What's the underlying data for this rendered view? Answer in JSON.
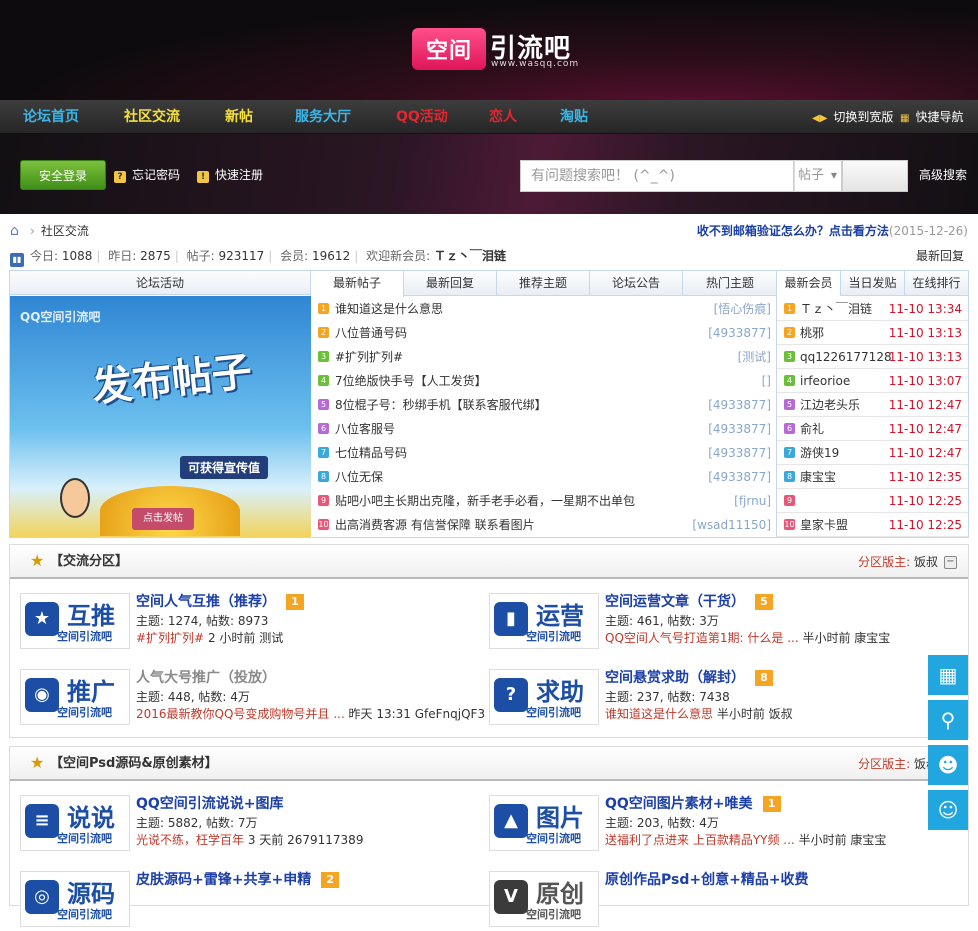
{
  "header": {
    "logo_mark": "空间",
    "logo_word": "引流吧",
    "logo_url": "www.wasqq.com"
  },
  "nav": {
    "items": [
      {
        "label": "论坛首页",
        "color": "#3ab7e8"
      },
      {
        "label": "社区交流",
        "color": "#f5e13a"
      },
      {
        "label": "新帖",
        "color": "#f5e13a"
      },
      {
        "label": "服务大厅",
        "color": "#3ab7e8"
      },
      {
        "label": "QQ活动",
        "color": "#e8242e"
      },
      {
        "label": "恋人",
        "color": "#e8242e"
      },
      {
        "label": "淘贴",
        "color": "#3ab7e8"
      }
    ],
    "switch_wide": "切换到宽版",
    "quick_nav": "快捷导航"
  },
  "login": {
    "button": "安全登录",
    "forgot": "忘记密码",
    "register": "快速注册",
    "search_placeholder": "有问题搜索吧！ (^_^)",
    "search_type": "帖子",
    "advanced": "高级搜索"
  },
  "breadcrumb": {
    "current": "社区交流"
  },
  "notice": {
    "link": "收不到邮箱验证怎么办？点击看方法",
    "date": "(2015-12-26)"
  },
  "stats": {
    "today_label": "今日:",
    "today": "1088",
    "yesterday_label": "昨日:",
    "yesterday": "2875",
    "posts_label": "帖子:",
    "posts": "923117",
    "members_label": "会员:",
    "members": "19612",
    "welcome_label": "欢迎新会员:",
    "new_member": "Ｔｚ丶￣泪链",
    "latest_reply": "最新回复"
  },
  "activity": {
    "head": "论坛活动",
    "brand": "QQ空间引流吧",
    "big": "发布帖子",
    "sub": "可获得宣传值",
    "btn": "点击发帖"
  },
  "post_tabs": [
    "最新帖子",
    "最新回复",
    "推荐主题",
    "论坛公告",
    "热门主题"
  ],
  "posts": [
    {
      "n": "1",
      "title": "谁知道这是什么意思",
      "author": "[悟心伤痕]",
      "color": "#f5a521"
    },
    {
      "n": "2",
      "title": "八位普通号码",
      "author": "[4933877]",
      "color": "#f5a521"
    },
    {
      "n": "3",
      "title": "#扩列扩列#",
      "author": "[测试]",
      "color": "#6cbf3b"
    },
    {
      "n": "4",
      "title": "7位绝版快手号【人工发货】",
      "author": "[]",
      "color": "#6cbf3b"
    },
    {
      "n": "5",
      "title": "8位棍子号：秒绑手机【联系客服代绑】",
      "author": "[4933877]",
      "color": "#b56bd6"
    },
    {
      "n": "6",
      "title": "八位客服号",
      "author": "[4933877]",
      "color": "#b56bd6"
    },
    {
      "n": "7",
      "title": "七位精品号码",
      "author": "[4933877]",
      "color": "#3aa8d8"
    },
    {
      "n": "8",
      "title": "八位无保",
      "author": "[4933877]",
      "color": "#3aa8d8"
    },
    {
      "n": "9",
      "title": "贴吧小吧主长期出克隆，新手老手必看，一星期不出单包",
      "author": "[fjrnu]",
      "color": "#e8577a"
    },
    {
      "n": "10",
      "title": "出高消费客源  有信誉保障  联系看图片",
      "author": "[wsad11150]",
      "color": "#e8577a"
    }
  ],
  "member_tabs": [
    "最新会员",
    "当日发贴",
    "在线排行"
  ],
  "members": [
    {
      "n": "1",
      "name": "Ｔｚ丶￣泪链",
      "time": "11-10 13:34",
      "color": "#f5a521"
    },
    {
      "n": "2",
      "name": "桃邪",
      "time": "11-10 13:13",
      "color": "#f5a521"
    },
    {
      "n": "3",
      "name": "qq1226177128",
      "time": "11-10 13:13",
      "color": "#6cbf3b"
    },
    {
      "n": "4",
      "name": "irfeorioe",
      "time": "11-10 13:07",
      "color": "#6cbf3b"
    },
    {
      "n": "5",
      "name": "江边老头乐",
      "time": "11-10 12:47",
      "color": "#b56bd6"
    },
    {
      "n": "6",
      "name": "俞礼",
      "time": "11-10 12:47",
      "color": "#b56bd6"
    },
    {
      "n": "7",
      "name": "游侠19",
      "time": "11-10 12:47",
      "color": "#3aa8d8"
    },
    {
      "n": "8",
      "name": "康宝宝",
      "time": "11-10 12:35",
      "color": "#3aa8d8"
    },
    {
      "n": "9",
      "name": "",
      "time": "11-10 12:25",
      "color": "#e8577a"
    },
    {
      "n": "10",
      "name": "皇家卡盟",
      "time": "11-10 12:25",
      "color": "#e8577a"
    }
  ],
  "section1": {
    "title": "【交流分区】",
    "moderator_label": "分区版主:",
    "moderator": "饭叔",
    "forums": [
      {
        "icon_big": "互推",
        "icon_site": "空间引流吧",
        "icon_pic": "★",
        "name": "空间人气互推（推荐）",
        "badge": "1",
        "stats": "主题: 1274, 帖数: 8973",
        "last": "#扩列扩列#",
        "last_time": "2 小时前  测试"
      },
      {
        "icon_big": "运营",
        "icon_site": "空间引流吧",
        "icon_pic": "▮",
        "name": "空间运营文章（干货）",
        "badge": "5",
        "stats": "主题: 461, 帖数: 3万",
        "last": "QQ空间人气号打造第1期: 什么是 ...",
        "last_time": "半小时前  康宝宝"
      },
      {
        "icon_big": "推广",
        "icon_site": "空间引流吧",
        "icon_pic": "◉",
        "name": "人气大号推广（投放）",
        "badge": "",
        "stats": "主题: 448, 帖数: 4万",
        "last": "2016最新教你QQ号变成购物号并且 ...",
        "last_time": "昨天 13:31  GfeFnqjQF3"
      },
      {
        "icon_big": "求助",
        "icon_site": "空间引流吧",
        "icon_pic": "?",
        "name": "空间悬赏求助（解封）",
        "badge": "8",
        "stats": "主题: 237, 帖数: 7438",
        "last": "谁知道这是什么意思",
        "last_time": "半小时前  饭叔"
      }
    ]
  },
  "section2": {
    "title": "【空间Psd源码&原创素材】",
    "moderator_label": "分区版主:",
    "moderator": "饭叔",
    "forums": [
      {
        "icon_big": "说说",
        "icon_site": "空间引流吧",
        "icon_pic": "≡",
        "name": "QQ空间引流说说+图库",
        "badge": "",
        "stats": "主题: 5882, 帖数: 7万",
        "last": "光说不练，枉学百年",
        "last_time": "3 天前  2679117389"
      },
      {
        "icon_big": "图片",
        "icon_site": "空间引流吧",
        "icon_pic": "▲",
        "name": "QQ空间图片素材+唯美",
        "badge": "1",
        "stats": "主题: 203, 帖数: 4万",
        "last": "送福利了点进来  上百款精品YY频 ...",
        "last_time": "半小时前  康宝宝"
      },
      {
        "icon_big": "源码",
        "icon_site": "空间引流吧",
        "icon_pic": "◎",
        "name": "皮肤源码+雷锋+共享+申精",
        "badge": "2",
        "stats": "",
        "last": "",
        "last_time": ""
      },
      {
        "icon_big": "原创",
        "icon_site": "空间引流吧",
        "icon_pic": "V",
        "name": "原创作品Psd+创意+精品+收费",
        "badge": "",
        "stats": "",
        "last": "",
        "last_time": ""
      }
    ]
  },
  "float_buttons": [
    "calendar-icon",
    "search-icon",
    "qq-icon",
    "user-icon"
  ]
}
